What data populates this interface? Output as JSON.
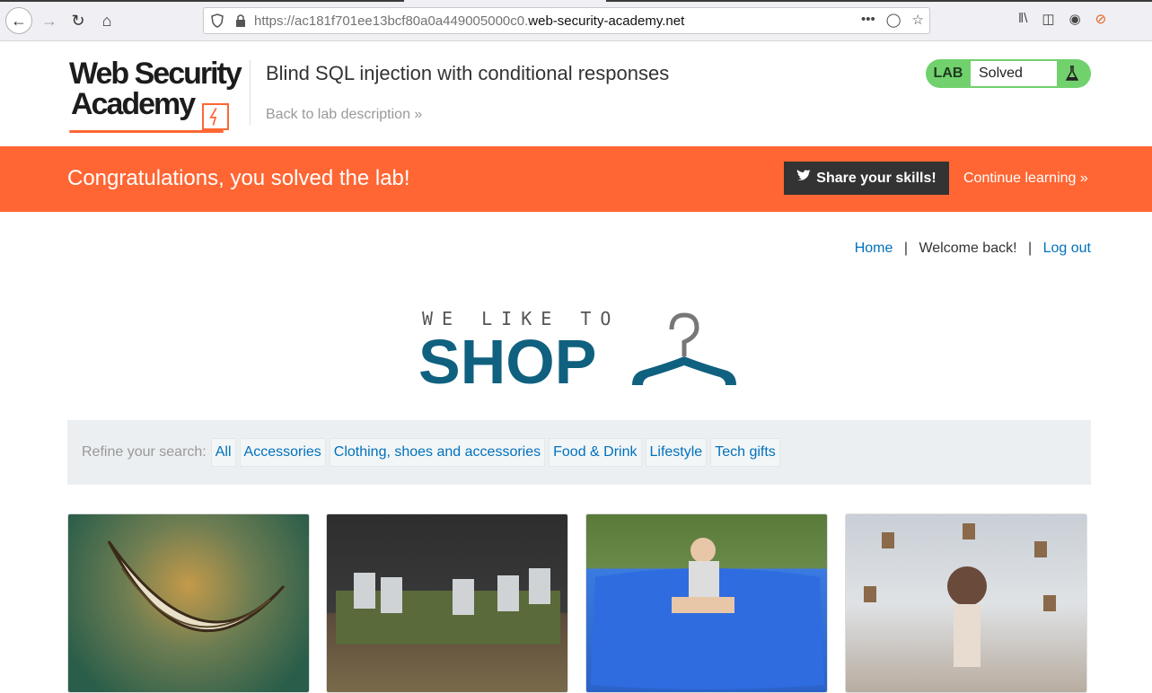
{
  "browser": {
    "url_prefix": "https://ac181f701ee13bcf80a0a449005000c0.",
    "url_domain": "web-security-academy.net"
  },
  "header": {
    "logo_line1": "Web Security",
    "logo_line2": "Academy",
    "lab_title": "Blind SQL injection with conditional responses",
    "back_link": "Back to lab description »",
    "lab_badge": "LAB",
    "lab_status": "Solved"
  },
  "banner": {
    "message": "Congratulations, you solved the lab!",
    "share_label": "Share your skills!",
    "continue_label": "Continue learning »"
  },
  "topnav": {
    "home": "Home",
    "welcome": "Welcome back!",
    "logout": "Log out",
    "separator": "|"
  },
  "shop_logo": {
    "tagline": "WE LIKE TO",
    "brand": "SHOP"
  },
  "filter": {
    "label": "Refine your search:",
    "categories": [
      "All",
      "Accessories",
      "Clothing, shoes and accessories",
      "Food & Drink",
      "Lifestyle",
      "Tech gifts"
    ]
  },
  "colors": {
    "accent_orange": "#ff6633",
    "link_blue": "#0071bc",
    "shop_blue": "#10607f",
    "lab_green": "#70d16d"
  },
  "icons": [
    "back-arrow-icon",
    "forward-arrow-icon",
    "reload-icon",
    "home-icon",
    "shield-icon",
    "lock-icon",
    "more-icon",
    "pocket-icon",
    "star-icon",
    "library-icon",
    "sidebar-icon",
    "account-icon",
    "extension-icon",
    "flask-icon",
    "twitter-icon",
    "hanger-icon"
  ]
}
